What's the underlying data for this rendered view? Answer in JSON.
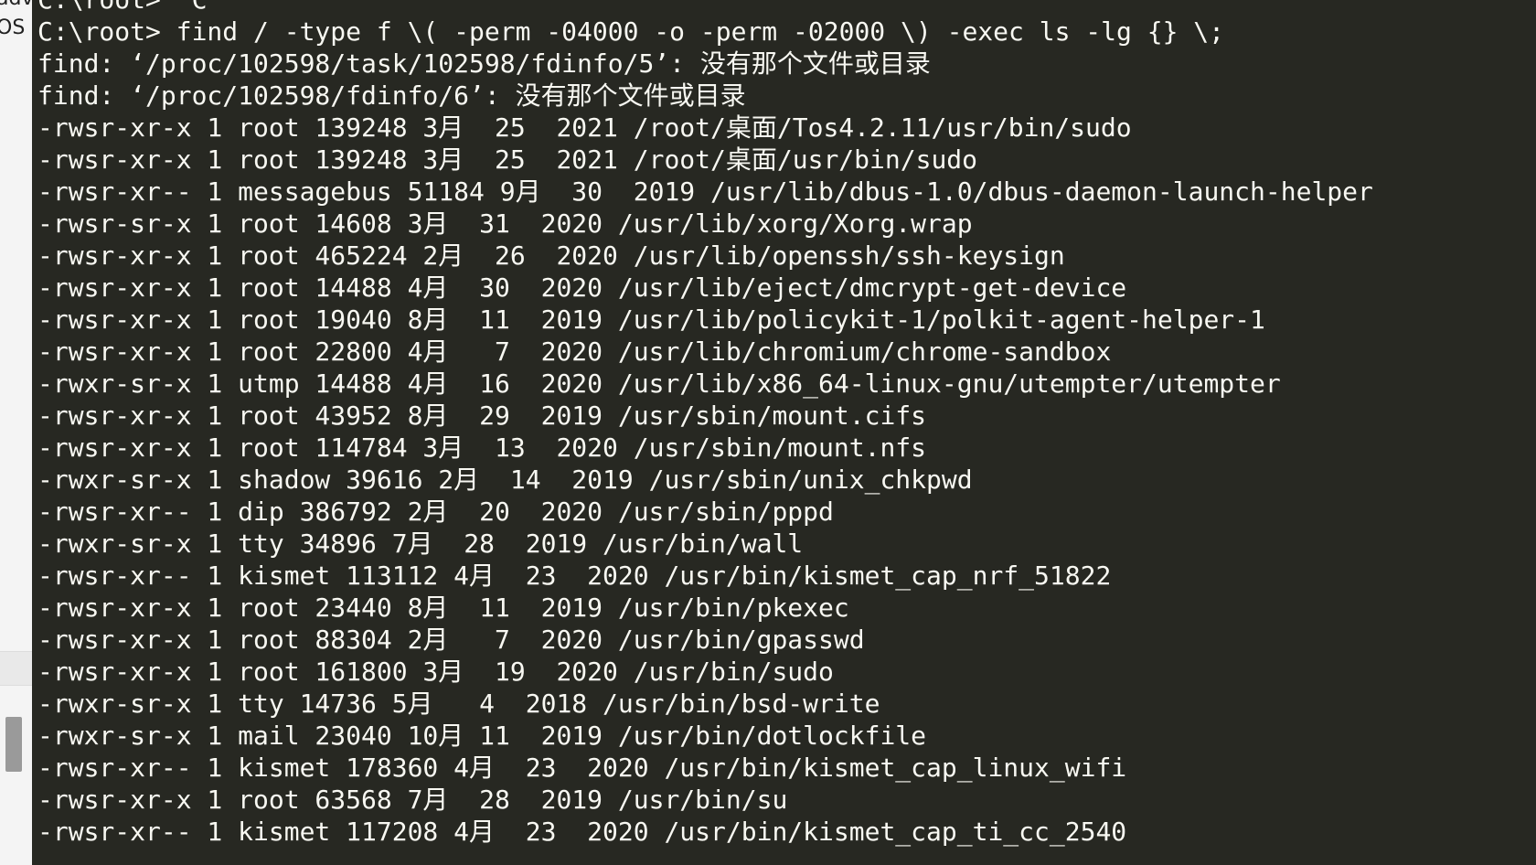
{
  "side_panel": {
    "label_top": "adv",
    "label_second": "OS"
  },
  "terminal": {
    "previous_line": "C:\\root> ^C",
    "lines": [
      "C:\\root> find / -type f \\( -perm -04000 -o -perm -02000 \\) -exec ls -lg {} \\;",
      "find: ‘/proc/102598/task/102598/fdinfo/5’: 没有那个文件或目录",
      "find: ‘/proc/102598/fdinfo/6’: 没有那个文件或目录",
      "-rwsr-xr-x 1 root 139248 3月  25  2021 /root/桌面/Tos4.2.11/usr/bin/sudo",
      "-rwsr-xr-x 1 root 139248 3月  25  2021 /root/桌面/usr/bin/sudo",
      "-rwsr-xr-- 1 messagebus 51184 9月  30  2019 /usr/lib/dbus-1.0/dbus-daemon-launch-helper",
      "-rwsr-sr-x 1 root 14608 3月  31  2020 /usr/lib/xorg/Xorg.wrap",
      "-rwsr-xr-x 1 root 465224 2月  26  2020 /usr/lib/openssh/ssh-keysign",
      "-rwsr-xr-x 1 root 14488 4月  30  2020 /usr/lib/eject/dmcrypt-get-device",
      "-rwsr-xr-x 1 root 19040 8月  11  2019 /usr/lib/policykit-1/polkit-agent-helper-1",
      "-rwsr-xr-x 1 root 22800 4月   7  2020 /usr/lib/chromium/chrome-sandbox",
      "-rwxr-sr-x 1 utmp 14488 4月  16  2020 /usr/lib/x86_64-linux-gnu/utempter/utempter",
      "-rwsr-xr-x 1 root 43952 8月  29  2019 /usr/sbin/mount.cifs",
      "-rwsr-xr-x 1 root 114784 3月  13  2020 /usr/sbin/mount.nfs",
      "-rwxr-sr-x 1 shadow 39616 2月  14  2019 /usr/sbin/unix_chkpwd",
      "-rwsr-xr-- 1 dip 386792 2月  20  2020 /usr/sbin/pppd",
      "-rwxr-sr-x 1 tty 34896 7月  28  2019 /usr/bin/wall",
      "-rwsr-xr-- 1 kismet 113112 4月  23  2020 /usr/bin/kismet_cap_nrf_51822",
      "-rwsr-xr-x 1 root 23440 8月  11  2019 /usr/bin/pkexec",
      "-rwsr-xr-x 1 root 88304 2月   7  2020 /usr/bin/gpasswd",
      "-rwsr-xr-x 1 root 161800 3月  19  2020 /usr/bin/sudo",
      "-rwxr-sr-x 1 tty 14736 5月   4  2018 /usr/bin/bsd-write",
      "-rwxr-sr-x 1 mail 23040 10月 11  2019 /usr/bin/dotlockfile",
      "-rwsr-xr-- 1 kismet 178360 4月  23  2020 /usr/bin/kismet_cap_linux_wifi",
      "-rwsr-xr-x 1 root 63568 7月  28  2019 /usr/bin/su",
      "-rwsr-xr-- 1 kismet 117208 4月  23  2020 /usr/bin/kismet_cap_ti_cc_2540"
    ]
  }
}
